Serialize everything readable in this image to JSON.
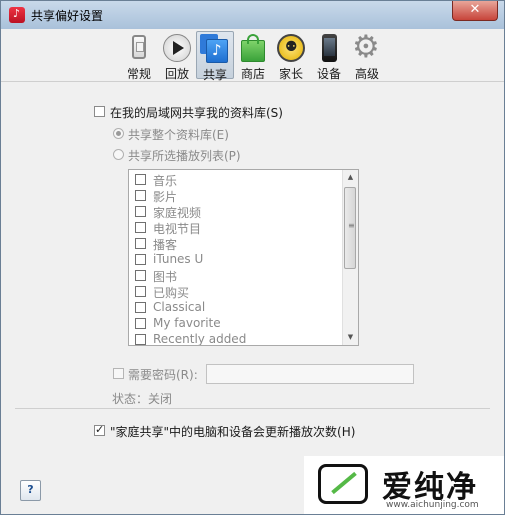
{
  "window": {
    "title": "共享偏好设置",
    "close_label": "✕"
  },
  "toolbar": {
    "items": [
      {
        "label": "常规",
        "icon": "general-icon"
      },
      {
        "label": "回放",
        "icon": "playback-icon"
      },
      {
        "label": "共享",
        "icon": "sharing-icon"
      },
      {
        "label": "商店",
        "icon": "store-icon"
      },
      {
        "label": "家长",
        "icon": "parental-icon"
      },
      {
        "label": "设备",
        "icon": "devices-icon"
      },
      {
        "label": "高级",
        "icon": "advanced-icon"
      }
    ],
    "active": "共享"
  },
  "sharing": {
    "share_library_label": "在我的局域网共享我的资料库(S)",
    "share_library_checked": false,
    "share_entire_label": "共享整个资料库(E)",
    "share_selected_label": "共享所选播放列表(P)",
    "playlists": [
      "音乐",
      "影片",
      "家庭视频",
      "电视节目",
      "播客",
      "iTunes U",
      "图书",
      "已购买",
      "Classical",
      "My favorite",
      "Recently added"
    ],
    "require_password_label": "需要密码(R):",
    "password_value": "",
    "status_label": "状态：关闭",
    "home_sharing_label": "\"家庭共享\"中的电脑和设备会更新播放次数(H)",
    "home_sharing_checked": true
  },
  "help_label": "?",
  "watermark": {
    "brand": "爱纯净",
    "url": "www.aichunjing.com"
  }
}
